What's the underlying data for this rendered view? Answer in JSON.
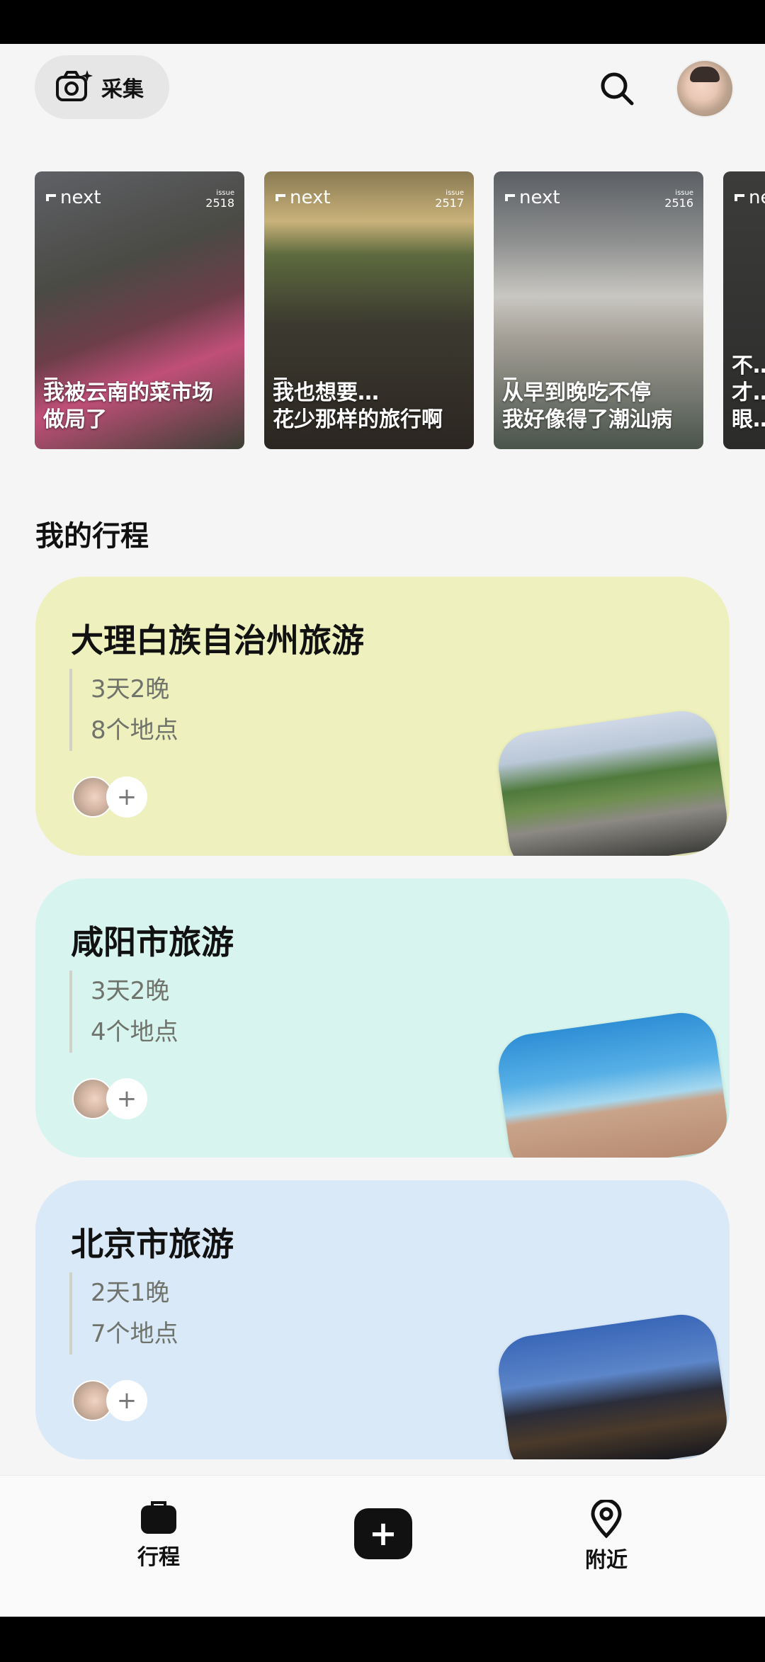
{
  "header": {
    "collect_label": "采集"
  },
  "stories": [
    {
      "brand": "next",
      "issue_label": "issue",
      "issue_no": "2518",
      "caption": "我被云南的菜市场\n做局了"
    },
    {
      "brand": "next",
      "issue_label": "issue",
      "issue_no": "2517",
      "caption": "我也想要…\n花少那样的旅行啊"
    },
    {
      "brand": "next",
      "issue_label": "issue",
      "issue_no": "2516",
      "caption": "从早到晚吃不停\n我好像得了潮汕病"
    },
    {
      "brand": "ne",
      "issue_label": "",
      "issue_no": "",
      "caption": "不…\n才…\n眼…"
    }
  ],
  "section": {
    "title": "我的行程"
  },
  "trips": [
    {
      "title": "大理白族自治州旅游",
      "duration": "3天2晚",
      "places": "8个地点",
      "bg": "#eef0bd"
    },
    {
      "title": "咸阳市旅游",
      "duration": "3天2晚",
      "places": "4个地点",
      "bg": "#d7f5ee"
    },
    {
      "title": "北京市旅游",
      "duration": "2天1晚",
      "places": "7个地点",
      "bg": "#d9e9f8"
    }
  ],
  "tabbar": {
    "trips_label": "行程",
    "nearby_label": "附近",
    "add_label": "+"
  },
  "colors": {
    "accent": "#111111",
    "trip1": "#eef0bd",
    "trip2": "#d7f5ee",
    "trip3": "#d9e9f8"
  }
}
